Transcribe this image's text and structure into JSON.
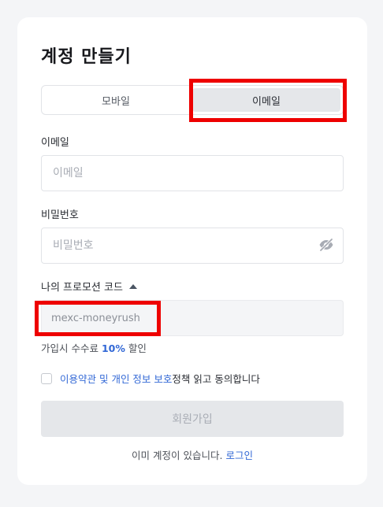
{
  "form": {
    "title": "계정 만들기",
    "tabs": [
      {
        "label": "모바일",
        "active": false
      },
      {
        "label": "이메일",
        "active": true
      }
    ],
    "email": {
      "label": "이메일",
      "placeholder": "이메일",
      "value": ""
    },
    "password": {
      "label": "비밀번호",
      "placeholder": "비밀번호",
      "value": "",
      "toggle_icon": "eye-slash-icon"
    },
    "promo": {
      "label": "나의 프로모션 코드",
      "caret_icon": "caret-up-icon",
      "code": "mexc-moneyrush",
      "note_prefix": "가입시 수수료 ",
      "note_percent": "10%",
      "note_suffix": " 할인"
    },
    "agreement": {
      "checked": false,
      "link_text": "이용약관 및 개인 정보 보호",
      "text": " 정책 읽고 동의합니다"
    },
    "submit_label": "회원가입",
    "footer": {
      "text": "이미 계정이 있습니다. ",
      "link": "로그인"
    }
  },
  "colors": {
    "page_bg": "#f4f5f7",
    "card_bg": "#ffffff",
    "accent": "#3268d6",
    "highlight": "#ee0000",
    "disabled_button": "#e5e7ea"
  }
}
